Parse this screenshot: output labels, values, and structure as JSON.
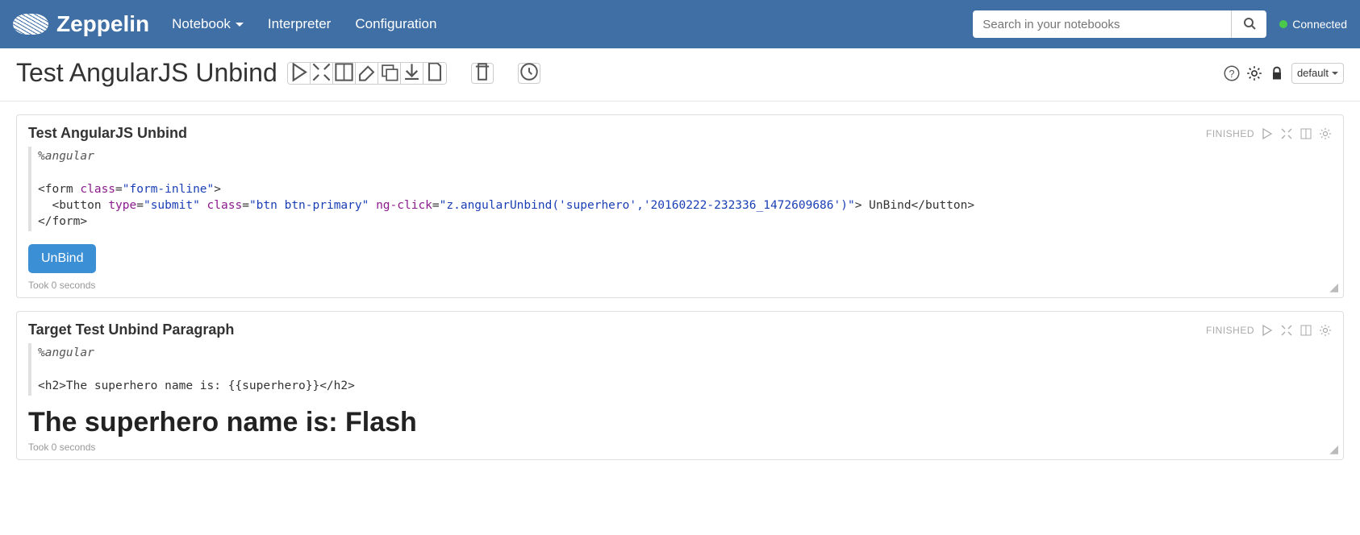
{
  "brand": "Zeppelin",
  "nav": {
    "notebook": "Notebook",
    "interpreter": "Interpreter",
    "configuration": "Configuration"
  },
  "search": {
    "placeholder": "Search in your notebooks"
  },
  "status": {
    "connected_label": "Connected"
  },
  "notebook_title": "Test AngularJS Unbind",
  "mode_label": "default",
  "paragraphs": [
    {
      "title": "Test AngularJS Unbind",
      "status": "FINISHED",
      "directive": "%angular",
      "code_lines": [
        {
          "segments": [
            {
              "t": "tag",
              "v": "<form "
            },
            {
              "t": "attr-name",
              "v": "class"
            },
            {
              "t": "tag",
              "v": "="
            },
            {
              "t": "attr-value",
              "v": "\"form-inline\""
            },
            {
              "t": "tag",
              "v": ">"
            }
          ]
        },
        {
          "segments": [
            {
              "t": "tag",
              "v": "  <button "
            },
            {
              "t": "attr-name",
              "v": "type"
            },
            {
              "t": "tag",
              "v": "="
            },
            {
              "t": "attr-value",
              "v": "\"submit\""
            },
            {
              "t": "tag",
              "v": " "
            },
            {
              "t": "attr-name",
              "v": "class"
            },
            {
              "t": "tag",
              "v": "="
            },
            {
              "t": "attr-value",
              "v": "\"btn btn-primary\""
            },
            {
              "t": "tag",
              "v": " "
            },
            {
              "t": "attr-name",
              "v": "ng-click"
            },
            {
              "t": "tag",
              "v": "="
            },
            {
              "t": "attr-value",
              "v": "\"z.angularUnbind('superhero','20160222-232336_1472609686')\""
            },
            {
              "t": "tag",
              "v": "> UnBind</button>"
            }
          ]
        },
        {
          "segments": [
            {
              "t": "tag",
              "v": "</form>"
            }
          ]
        }
      ],
      "output_button": "UnBind",
      "timing": "Took 0 seconds"
    },
    {
      "title": "Target Test Unbind Paragraph",
      "status": "FINISHED",
      "directive": "%angular",
      "code_lines": [
        {
          "segments": [
            {
              "t": "tag",
              "v": "<h2>The superhero name is: {{superhero}}</h2>"
            }
          ]
        }
      ],
      "output_heading": "The superhero name is: Flash",
      "timing": "Took 0 seconds"
    }
  ]
}
